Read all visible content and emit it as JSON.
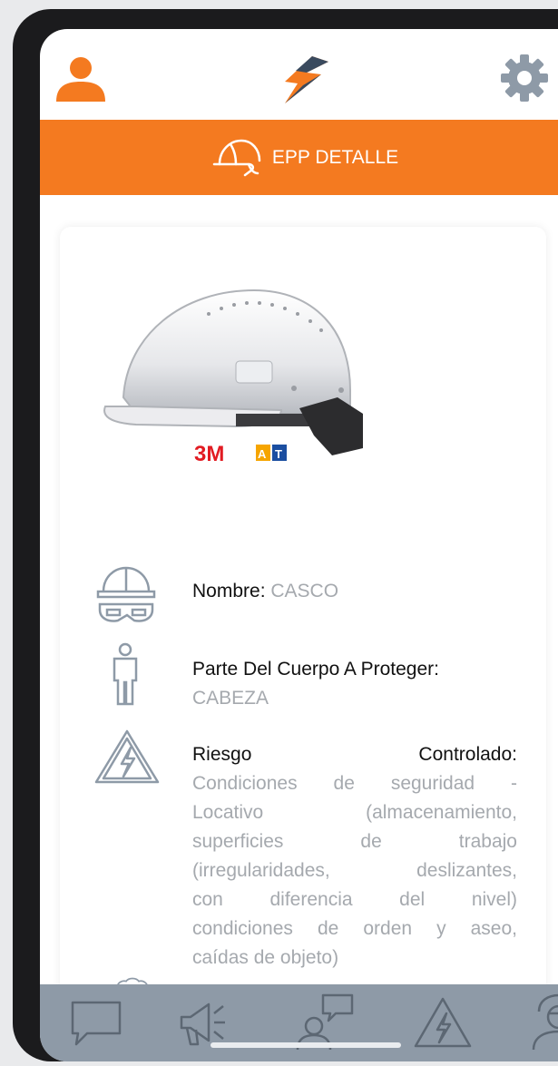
{
  "header": {
    "title": "EPP DETALLE"
  },
  "product": {
    "brand_badges": [
      "3M",
      "AT"
    ]
  },
  "details": [
    {
      "label": "Nombre:",
      "value": "CASCO",
      "icon": "helmet-goggles-icon"
    },
    {
      "label": "Parte Del Cuerpo A Proteger:",
      "value": "CABEZA",
      "icon": "body-figure-icon"
    },
    {
      "label_left": "Riesgo",
      "label_right": "Controlado:",
      "value_lines": [
        "Condiciones de seguridad -",
        "Locativo (almacenamiento,",
        "superficies de trabajo",
        "(irregularidades, deslizantes,",
        "con diferencia del nivel)",
        "condiciones de orden y aseo,",
        "caídas de objeto)"
      ],
      "icon": "electric-hazard-icon"
    }
  ],
  "bottom_nav": [
    {
      "name": "chat-icon"
    },
    {
      "name": "megaphone-icon"
    },
    {
      "name": "user-comment-icon"
    },
    {
      "name": "electric-hazard-icon"
    },
    {
      "name": "doctor-icon"
    }
  ],
  "colors": {
    "accent": "#f47a20",
    "nav_bar": "#8e9aa7",
    "icon_gray": "#8e9aa7",
    "value_text": "#a5a9ae"
  }
}
